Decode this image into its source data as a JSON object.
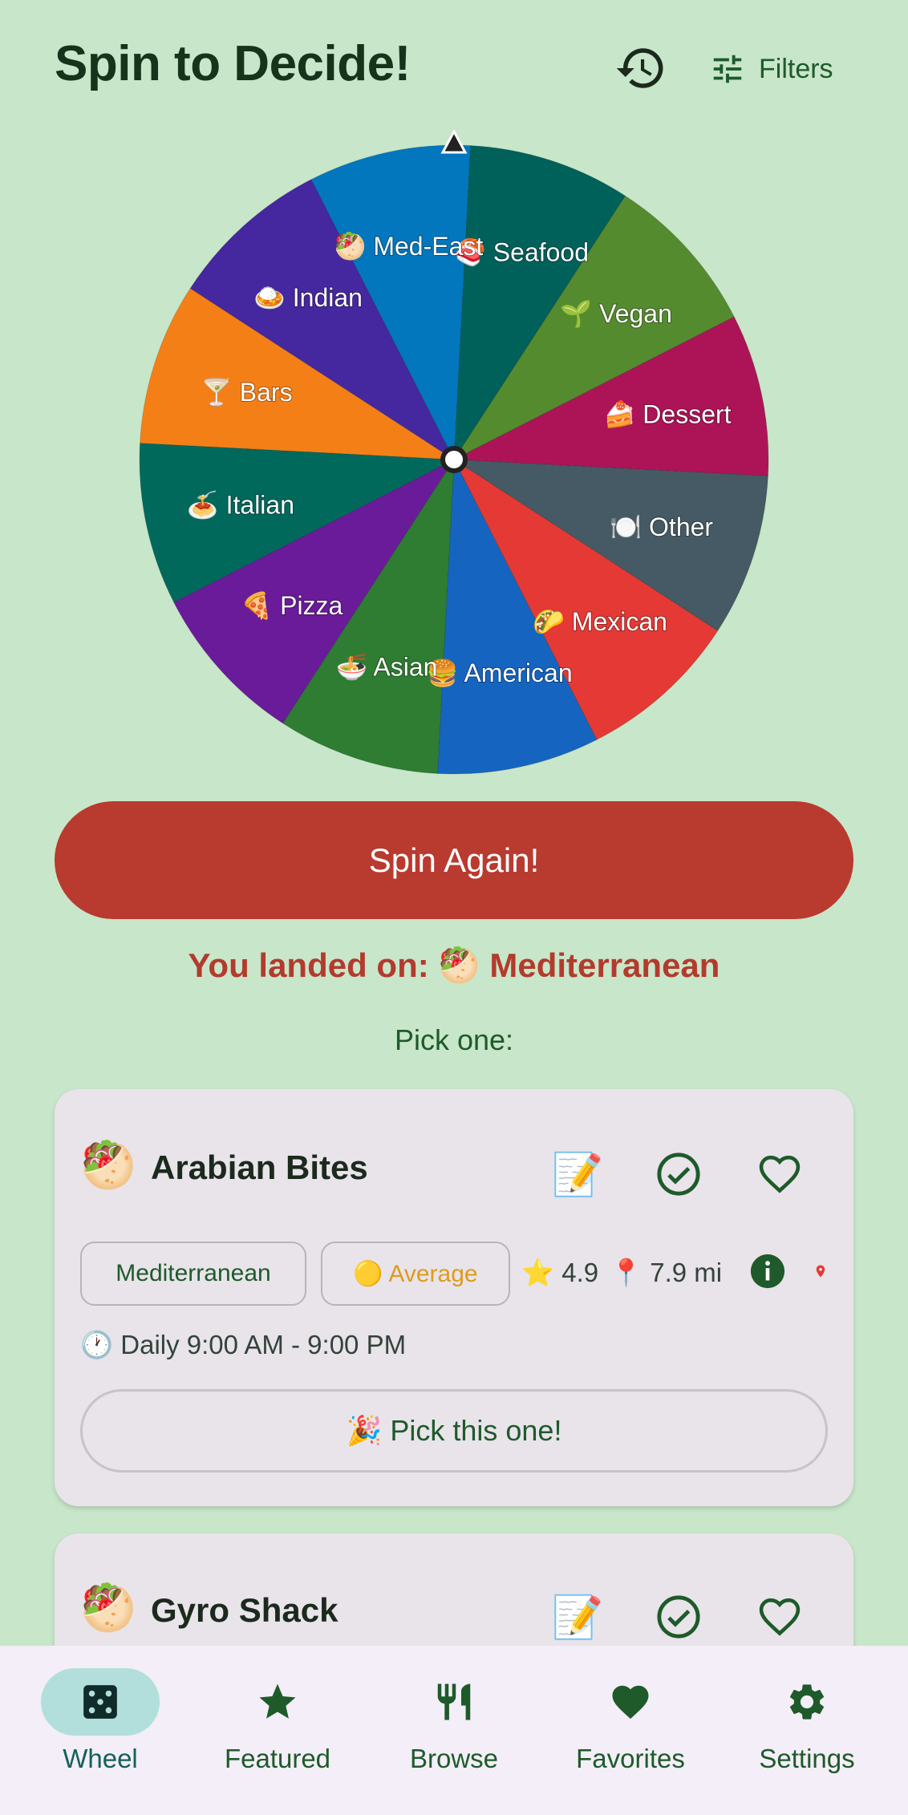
{
  "header": {
    "title": "Spin to Decide!",
    "history_icon": "history-icon",
    "filters_label": "Filters",
    "filters_icon": "tune-icon"
  },
  "wheel": {
    "segments": [
      {
        "label": "Seafood",
        "emoji": "🍣",
        "color": "#00615b"
      },
      {
        "label": "Vegan",
        "emoji": "🌱",
        "color": "#558b2f"
      },
      {
        "label": "Dessert",
        "emoji": "🍰",
        "color": "#ad1457"
      },
      {
        "label": "Other",
        "emoji": "🍽️",
        "color": "#455a64"
      },
      {
        "label": "Mexican",
        "emoji": "🌮",
        "color": "#e53935"
      },
      {
        "label": "American",
        "emoji": "🍔",
        "color": "#1565c0"
      },
      {
        "label": "Asian",
        "emoji": "🍜",
        "color": "#2e7d32"
      },
      {
        "label": "Pizza",
        "emoji": "🍕",
        "color": "#6a1b9a"
      },
      {
        "label": "Italian",
        "emoji": "🍝",
        "color": "#00695c"
      },
      {
        "label": "Bars",
        "emoji": "🍸",
        "color": "#f57f17"
      },
      {
        "label": "Indian",
        "emoji": "🍛",
        "color": "#4527a0"
      },
      {
        "label": "Med-East",
        "emoji": "🥙",
        "color": "#0277bd"
      }
    ]
  },
  "spin_button_label": "Spin Again!",
  "result_text": "You landed on: 🥙 Mediterranean",
  "pick_prompt": "Pick one:",
  "restaurants": [
    {
      "emoji": "🥙",
      "name": "Arabian Bites",
      "cuisine": "Mediterranean",
      "price": "🟡 Average",
      "rating": "⭐ 4.9",
      "distance": "📍 7.9 mi",
      "hours": "🕐 Daily 9:00 AM - 9:00 PM",
      "pick_label": "🎉 Pick this one!",
      "note_icon": "📝"
    },
    {
      "emoji": "🥙",
      "name": "Gyro Shack",
      "note_icon": "📝"
    }
  ],
  "colors": {
    "background": "#c8e6c9",
    "primary": "#1e5a2a",
    "spin_button": "#b93a2f",
    "card": "#e8e4ea",
    "nav_active": "#b2dfdb"
  },
  "nav": {
    "items": [
      {
        "label": "Wheel",
        "icon": "dice-icon",
        "active": true
      },
      {
        "label": "Featured",
        "icon": "star-icon"
      },
      {
        "label": "Browse",
        "icon": "restaurant-icon"
      },
      {
        "label": "Favorites",
        "icon": "heart-icon"
      },
      {
        "label": "Settings",
        "icon": "gear-icon"
      }
    ]
  }
}
